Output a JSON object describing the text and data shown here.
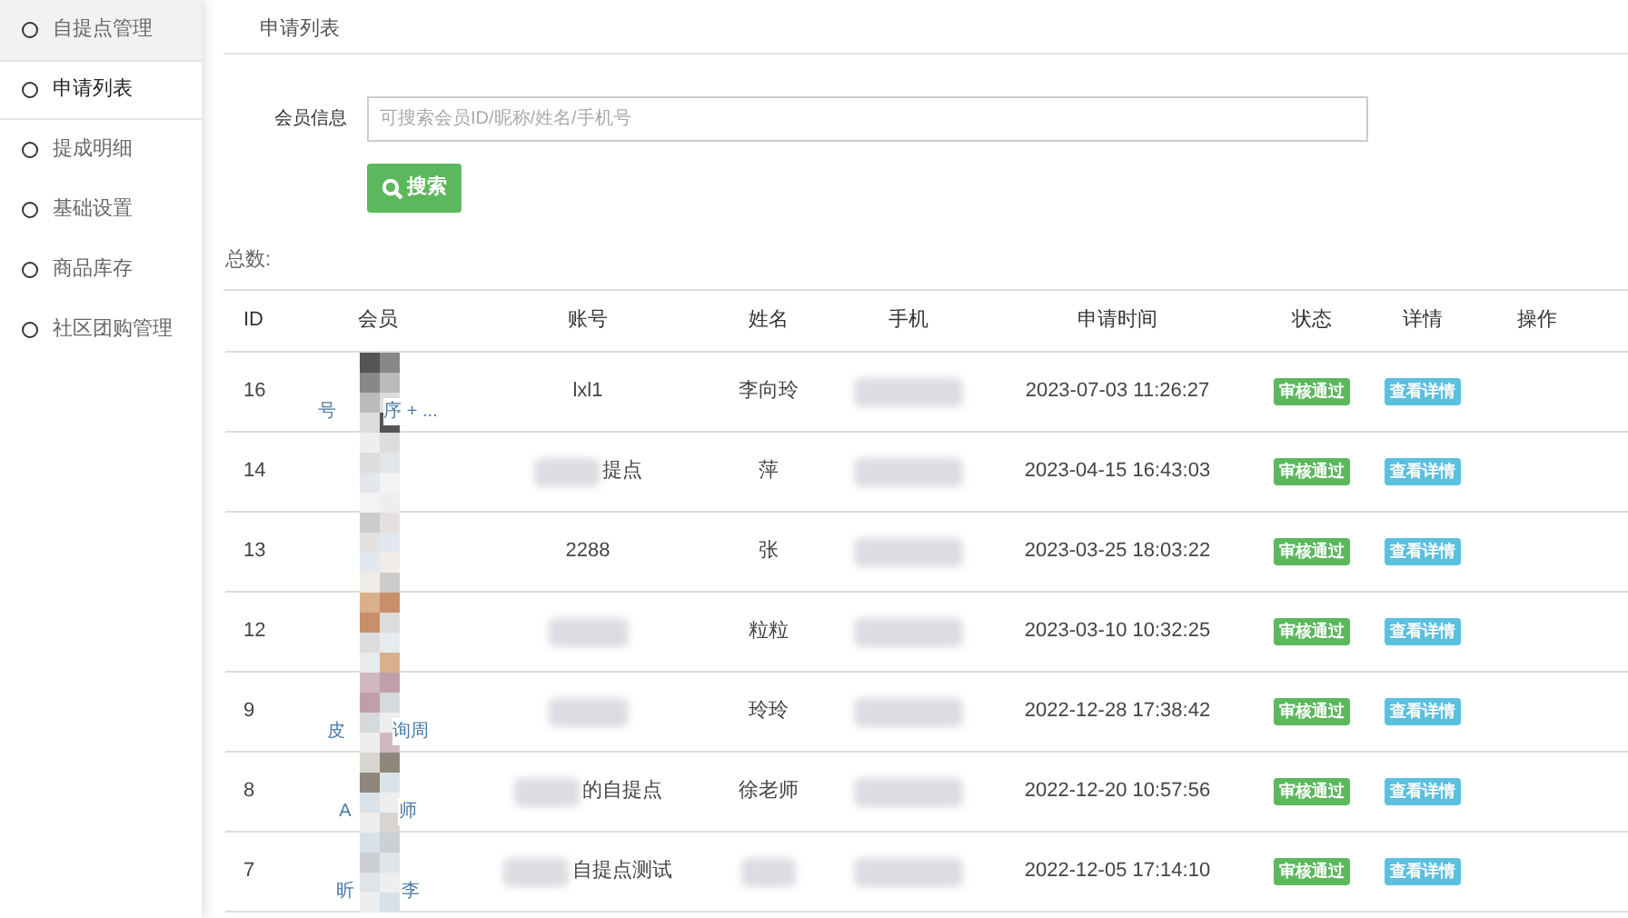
{
  "sidebar": {
    "items": [
      {
        "label": "自提点管理",
        "selected": false,
        "hovered": true
      },
      {
        "label": "申请列表",
        "selected": true,
        "hovered": false
      },
      {
        "label": "提成明细",
        "selected": false,
        "hovered": false
      },
      {
        "label": "基础设置",
        "selected": false,
        "hovered": false
      },
      {
        "label": "商品库存",
        "selected": false,
        "hovered": false
      },
      {
        "label": "社区团购管理",
        "selected": false,
        "hovered": false
      }
    ]
  },
  "page_title": "申请列表",
  "search": {
    "label": "会员信息",
    "placeholder": "可搜索会员ID/昵称/姓名/手机号",
    "button": "搜索"
  },
  "total_label": "总数:",
  "table": {
    "columns": [
      "ID",
      "会员",
      "账号",
      "姓名",
      "手机",
      "申请时间",
      "状态",
      "详情",
      "操作"
    ],
    "rows": [
      {
        "id": "16",
        "member": [
          "号",
          "序 + ..."
        ],
        "account": "lxl1",
        "account_blurred": false,
        "name": "李向玲",
        "time": "2023-07-03 11:26:27",
        "status": "审核通过",
        "detail": "查看详情"
      },
      {
        "id": "14",
        "member": [],
        "account": "提点",
        "account_blurred": true,
        "name": "萍",
        "time": "2023-04-15 16:43:03",
        "status": "审核通过",
        "detail": "查看详情"
      },
      {
        "id": "13",
        "member": [],
        "account": "2288",
        "account_blurred": false,
        "name": "张",
        "time": "2023-03-25 18:03:22",
        "status": "审核通过",
        "detail": "查看详情"
      },
      {
        "id": "12",
        "member": [],
        "account_blurred": true,
        "name": "粒粒",
        "time": "2023-03-10 10:32:25",
        "status": "审核通过",
        "detail": "查看详情"
      },
      {
        "id": "9",
        "member": [
          "皮",
          "询周"
        ],
        "account_blurred": true,
        "name": "玲玲",
        "time": "2022-12-28 17:38:42",
        "status": "审核通过",
        "detail": "查看详情"
      },
      {
        "id": "8",
        "member": [
          "A",
          "师"
        ],
        "account": "的自提点",
        "account_blurred": true,
        "name": "徐老师",
        "time": "2022-12-20 10:57:56",
        "status": "审核通过",
        "detail": "查看详情"
      },
      {
        "id": "7",
        "member": [
          "昕",
          "李"
        ],
        "account": "自提点测试",
        "account_blurred": true,
        "time": "2022-12-05 17:14:10",
        "status": "审核通过",
        "detail": "查看详情"
      }
    ]
  }
}
